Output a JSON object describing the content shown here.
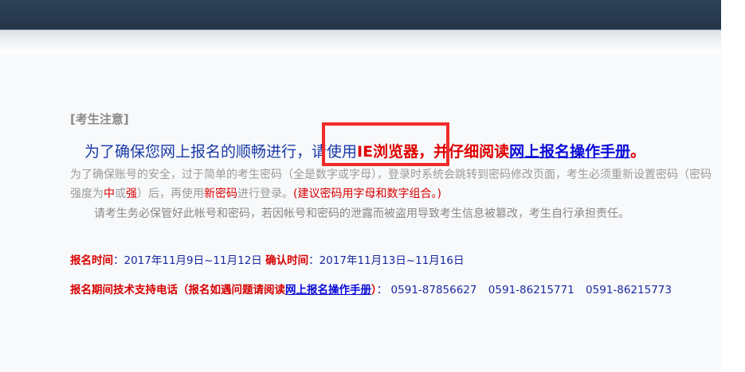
{
  "notice": {
    "title": "[考生注意]",
    "headline": {
      "part1": "为了确保您网上报名的顺畅进行，请使用",
      "ie": "IE浏览器，",
      "part2": "并仔细阅读",
      "manual_link": "网上报名操作手册",
      "end": "。"
    },
    "para1": {
      "text1": "为了确保账号的安全，过于简单的考生密码（全是数字或字母），登录时系统会跳转到密码修改页面，考生必须重新设置密码（密码强度为",
      "mid": "中",
      "or": "或",
      "strong": "强",
      "text2": "）后，再使用",
      "new_pwd": "新密码",
      "text3": "进行登录。",
      "advice": "(建议密码用字母和数字组合。)"
    },
    "para2": "请考生务必保管好此帐号和密码，若因帐号和密码的泄露而被盗用导致考生信息被篡改，考生自行承担责任。"
  },
  "schedule": {
    "reg_label": "报名时间",
    "reg_value": "2017年11月9日~11月12日",
    "confirm_label": "确认时间",
    "confirm_value": "2017年11月13日~11月16日"
  },
  "support": {
    "label_prefix": "报名期间技术支持电话（报名如遇问题请阅读",
    "manual_link": "网上报名操作手册",
    "label_suffix": "）",
    "phones": [
      "0591-87856627",
      "0591-86215771",
      "0591-86215773"
    ]
  }
}
